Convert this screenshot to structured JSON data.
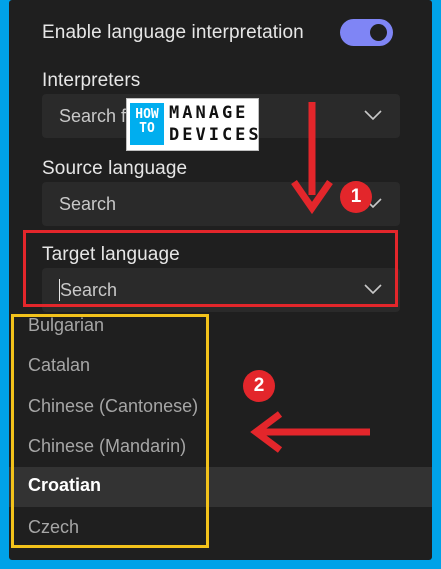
{
  "settings": {
    "enable_interpretation_label": "Enable language interpretation",
    "toggle_on": true,
    "interpreters_label": "Interpreters",
    "interpreters_placeholder": "Search f",
    "source_label": "Source language",
    "source_placeholder": "Search",
    "target_label": "Target language",
    "target_value": "Search"
  },
  "watermark": {
    "how": "HOW",
    "to": "TO",
    "manage": "MANAGE",
    "devices": "DEVICES"
  },
  "dropdown": {
    "options": [
      "Bulgarian",
      "Catalan",
      "Chinese (Cantonese)",
      "Chinese (Mandarin)",
      "Croatian",
      "Czech"
    ],
    "selected_index": 4
  },
  "annotations": {
    "badge_1": "1",
    "badge_2": "2"
  },
  "colors": {
    "background": "#00a2e8",
    "panel": "#1f1f1f",
    "toggle": "#7f85f5",
    "annotation_red": "#e3262b",
    "annotation_yellow": "#f2c21b"
  }
}
